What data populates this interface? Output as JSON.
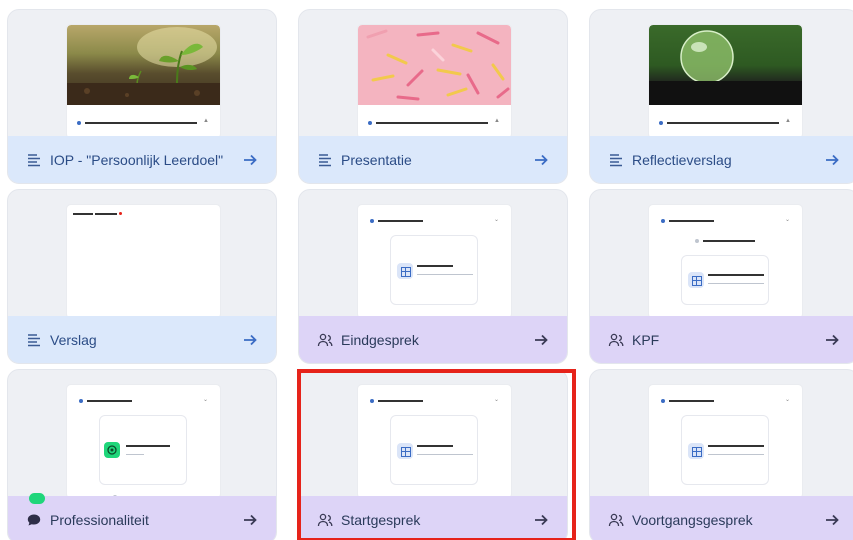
{
  "cards": [
    {
      "label": "IOP - \"Persoonlijk Leerdoel\"",
      "icon": "text-align-icon",
      "kind": "image-plant",
      "color": "blue"
    },
    {
      "label": "Presentatie",
      "icon": "text-align-icon",
      "kind": "image-clips",
      "color": "blue"
    },
    {
      "label": "Reflectieverslag",
      "icon": "text-align-icon",
      "kind": "image-ball",
      "color": "blue"
    },
    {
      "label": "Verslag",
      "icon": "text-align-icon",
      "kind": "doc",
      "color": "blue"
    },
    {
      "label": "Eindgesprek",
      "icon": "people-icon",
      "kind": "form",
      "color": "purple"
    },
    {
      "label": "KPF",
      "icon": "people-icon",
      "kind": "form2",
      "color": "purple"
    },
    {
      "label": "Professionaliteit",
      "icon": "chat-bubble-icon",
      "kind": "form3",
      "color": "purple"
    },
    {
      "label": "Startgesprek",
      "icon": "people-icon",
      "kind": "form",
      "color": "purple"
    },
    {
      "label": "Voortgangsgesprek",
      "icon": "people-icon",
      "kind": "form",
      "color": "purple"
    }
  ],
  "colors": {
    "blue_footer": "#dbe8fb",
    "purple_footer": "#ddd4f7",
    "arrow": "#3b6cc4",
    "highlight": "#e6231a",
    "toggle": "#1fd67a"
  }
}
